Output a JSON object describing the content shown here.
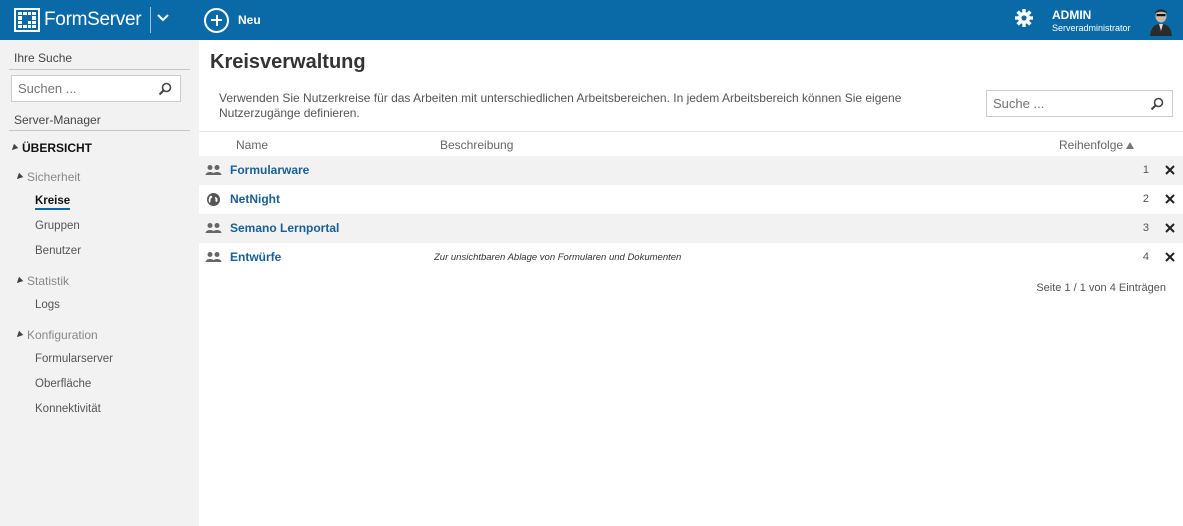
{
  "topbar": {
    "app_name": "FormServer",
    "new_label": "Neu",
    "user_name": "ADMIN",
    "user_role": "Serveradministrator"
  },
  "sidebar": {
    "search_heading": "Ihre Suche",
    "search_placeholder": "Suchen ...",
    "manager_heading": "Server-Manager",
    "overview": "ÜBERSICHT",
    "sections": [
      {
        "label": "Sicherheit",
        "items": [
          "Kreise",
          "Gruppen",
          "Benutzer"
        ]
      },
      {
        "label": "Statistik",
        "items": [
          "Logs"
        ]
      },
      {
        "label": "Konfiguration",
        "items": [
          "Formularserver",
          "Oberfläche",
          "Konnektivität"
        ]
      }
    ],
    "active_item": "Kreise"
  },
  "main": {
    "title": "Kreisverwaltung",
    "description": "Verwenden Sie Nutzerkreise für das Arbeiten mit unterschiedlichen Arbeitsbereichen. In jedem Arbeitsbereich können Sie eigene Nutzerzugänge definieren.",
    "search_placeholder": "Suche ...",
    "columns": {
      "name": "Name",
      "description": "Beschreibung",
      "order": "Reihenfolge"
    },
    "rows": [
      {
        "icon": "users-icon",
        "name": "Formularware",
        "description": "",
        "order": "1"
      },
      {
        "icon": "globe-icon",
        "name": "NetNight",
        "description": "",
        "order": "2"
      },
      {
        "icon": "users-icon",
        "name": "Semano Lernportal",
        "description": "",
        "order": "3"
      },
      {
        "icon": "users-icon",
        "name": "Entwürfe",
        "description": "Zur unsichtbaren Ablage von Formularen und Dokumenten",
        "order": "4"
      }
    ],
    "pager": "Seite 1 / 1 von 4 Einträgen"
  },
  "colors": {
    "topbar": "#0a6aa8",
    "link": "#1a5f94",
    "sidebar_bg": "#f2f2f2"
  }
}
